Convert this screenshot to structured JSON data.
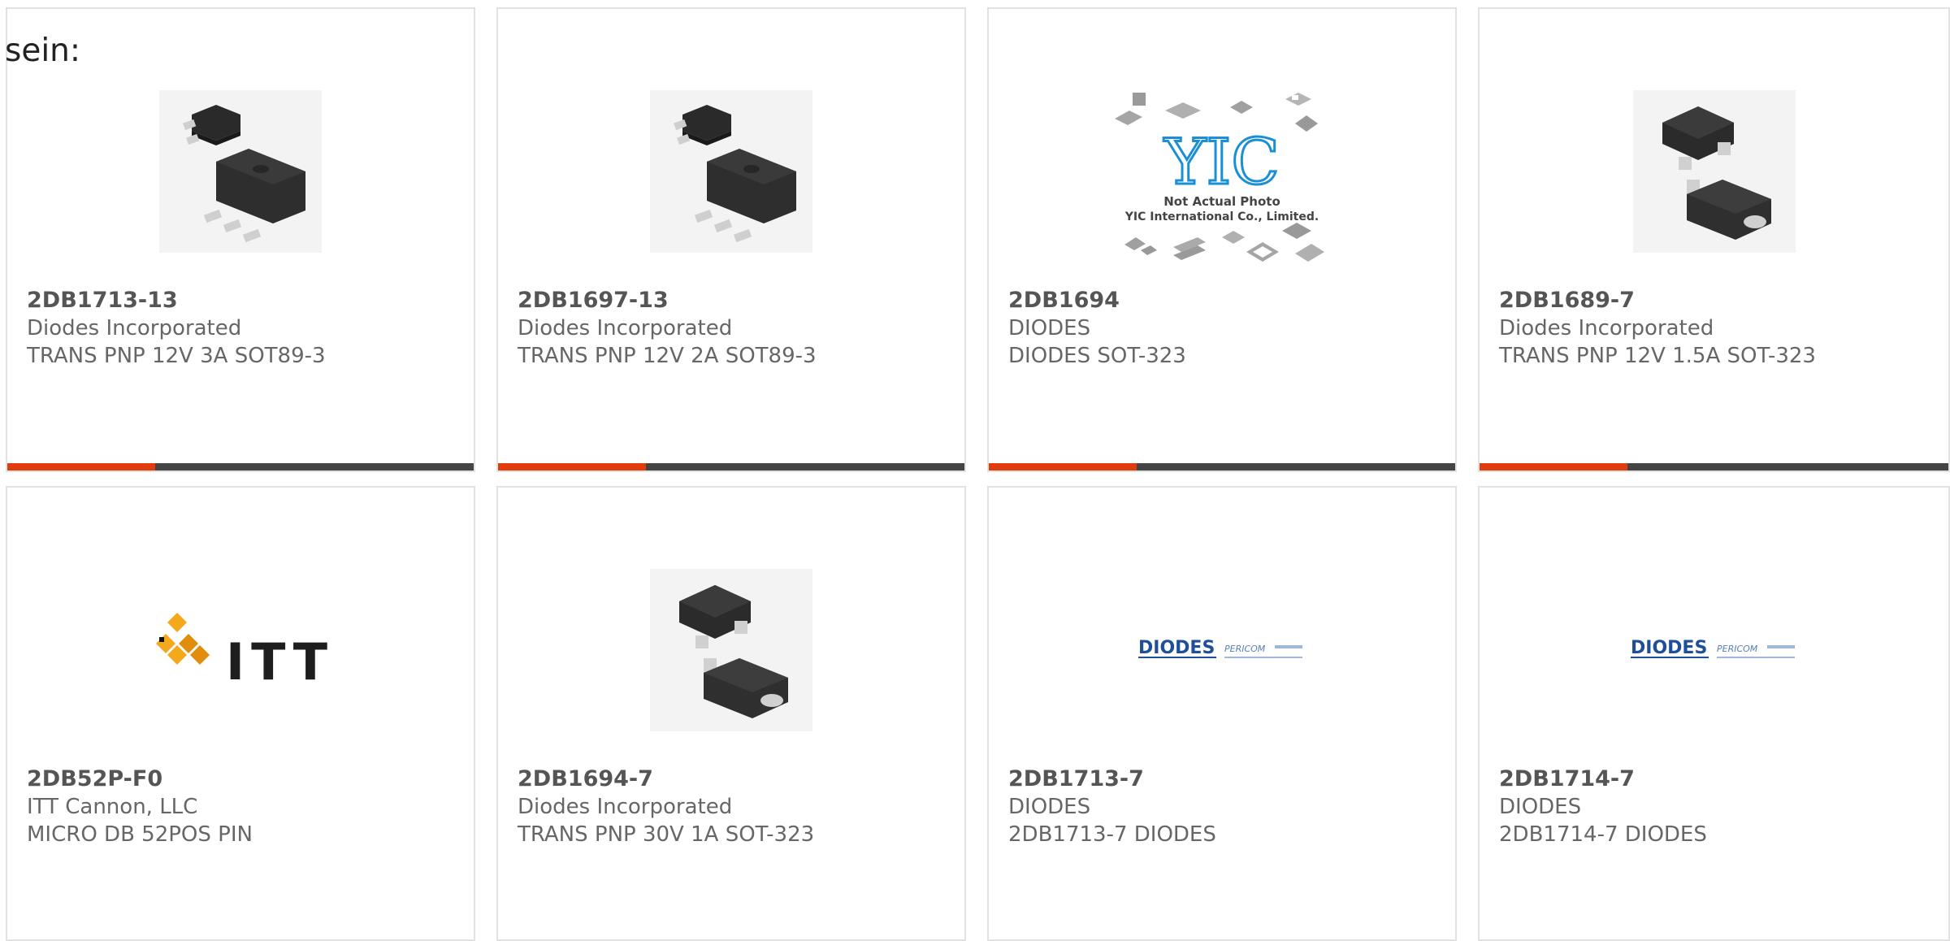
{
  "header": {
    "corner_label": "sein:"
  },
  "accent_color": "#e03c0e",
  "bar_color": "#444444",
  "products": [
    {
      "part": "2DB1713-13",
      "manufacturer": "Diodes Incorporated",
      "description": "TRANS PNP 12V 3A SOT89-3",
      "image": "sot89-package-icon",
      "highlight_bar": true
    },
    {
      "part": "2DB1697-13",
      "manufacturer": "Diodes Incorporated",
      "description": "TRANS PNP 12V 2A SOT89-3",
      "image": "sot89-package-icon",
      "highlight_bar": true
    },
    {
      "part": "2DB1694",
      "manufacturer": "DIODES",
      "description": "DIODES SOT-323",
      "image": "yic-placeholder-image",
      "image_text": {
        "logo": "YIC",
        "line1": "Not Actual Photo",
        "line2": "YIC International Co., Limited."
      },
      "highlight_bar": true
    },
    {
      "part": "2DB1689-7",
      "manufacturer": "Diodes Incorporated",
      "description": "TRANS PNP 12V 1.5A SOT-323",
      "image": "sot323-package-icon",
      "highlight_bar": true
    },
    {
      "part": "2DB52P-F0",
      "manufacturer": "ITT Cannon, LLC",
      "description": "MICRO DB 52POS PIN",
      "image": "itt-logo",
      "image_text": {
        "logo": "ITT"
      },
      "highlight_bar": false
    },
    {
      "part": "2DB1694-7",
      "manufacturer": "Diodes Incorporated",
      "description": "TRANS PNP 30V 1A SOT-323",
      "image": "sot323-package-icon",
      "highlight_bar": false
    },
    {
      "part": "2DB1713-7",
      "manufacturer": "DIODES",
      "description": "2DB1713-7 DIODES",
      "image": "diodes-pericom-logo",
      "image_text": {
        "logo": "DIODES",
        "sub": "PERICOM"
      },
      "highlight_bar": false
    },
    {
      "part": "2DB1714-7",
      "manufacturer": "DIODES",
      "description": "2DB1714-7 DIODES",
      "image": "diodes-pericom-logo",
      "image_text": {
        "logo": "DIODES",
        "sub": "PERICOM"
      },
      "highlight_bar": false
    }
  ]
}
